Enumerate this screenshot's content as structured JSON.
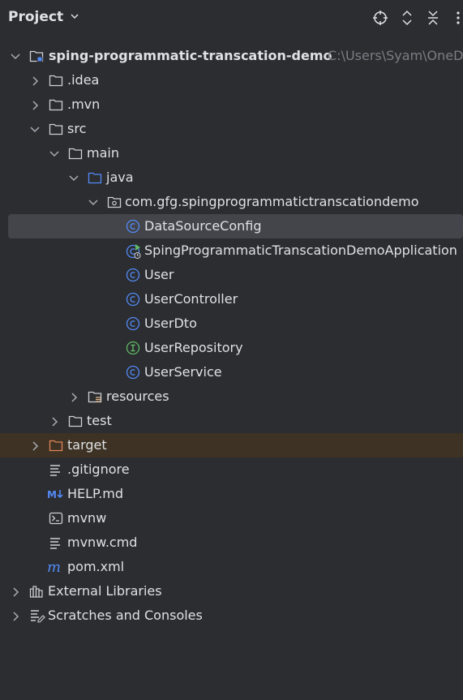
{
  "header": {
    "title": "Project",
    "tools": [
      "locate-icon",
      "expand-collapse-icon",
      "collapse-all-icon",
      "more-icon"
    ]
  },
  "tree": {
    "project": {
      "name": "sping-programmatic-transcation-demo",
      "path": "C:\\Users\\Syam\\OneDrive"
    },
    "idea": ".idea",
    "mvn": ".mvn",
    "src": "src",
    "main": "main",
    "java": "java",
    "package": "com.gfg.spingprogrammatictranscationdemo",
    "classes": [
      {
        "name": "DataSourceConfig",
        "kind": "class"
      },
      {
        "name": "SpingProgrammaticTranscationDemoApplication",
        "kind": "app"
      },
      {
        "name": "User",
        "kind": "class"
      },
      {
        "name": "UserController",
        "kind": "class"
      },
      {
        "name": "UserDto",
        "kind": "class"
      },
      {
        "name": "UserRepository",
        "kind": "interface"
      },
      {
        "name": "UserService",
        "kind": "class"
      }
    ],
    "resources": "resources",
    "test": "test",
    "target": "target",
    "files": [
      ".gitignore",
      "HELP.md",
      "mvnw",
      "mvnw.cmd",
      "pom.xml"
    ],
    "external": "External Libraries",
    "scratches": "Scratches and Consoles"
  },
  "colors": {
    "background": "#2b2d30",
    "selected": "#43454a",
    "target_row": "#3d3223",
    "class_icon": "#548af7",
    "interface_icon": "#5fb865",
    "target_folder": "#e0b48a"
  }
}
